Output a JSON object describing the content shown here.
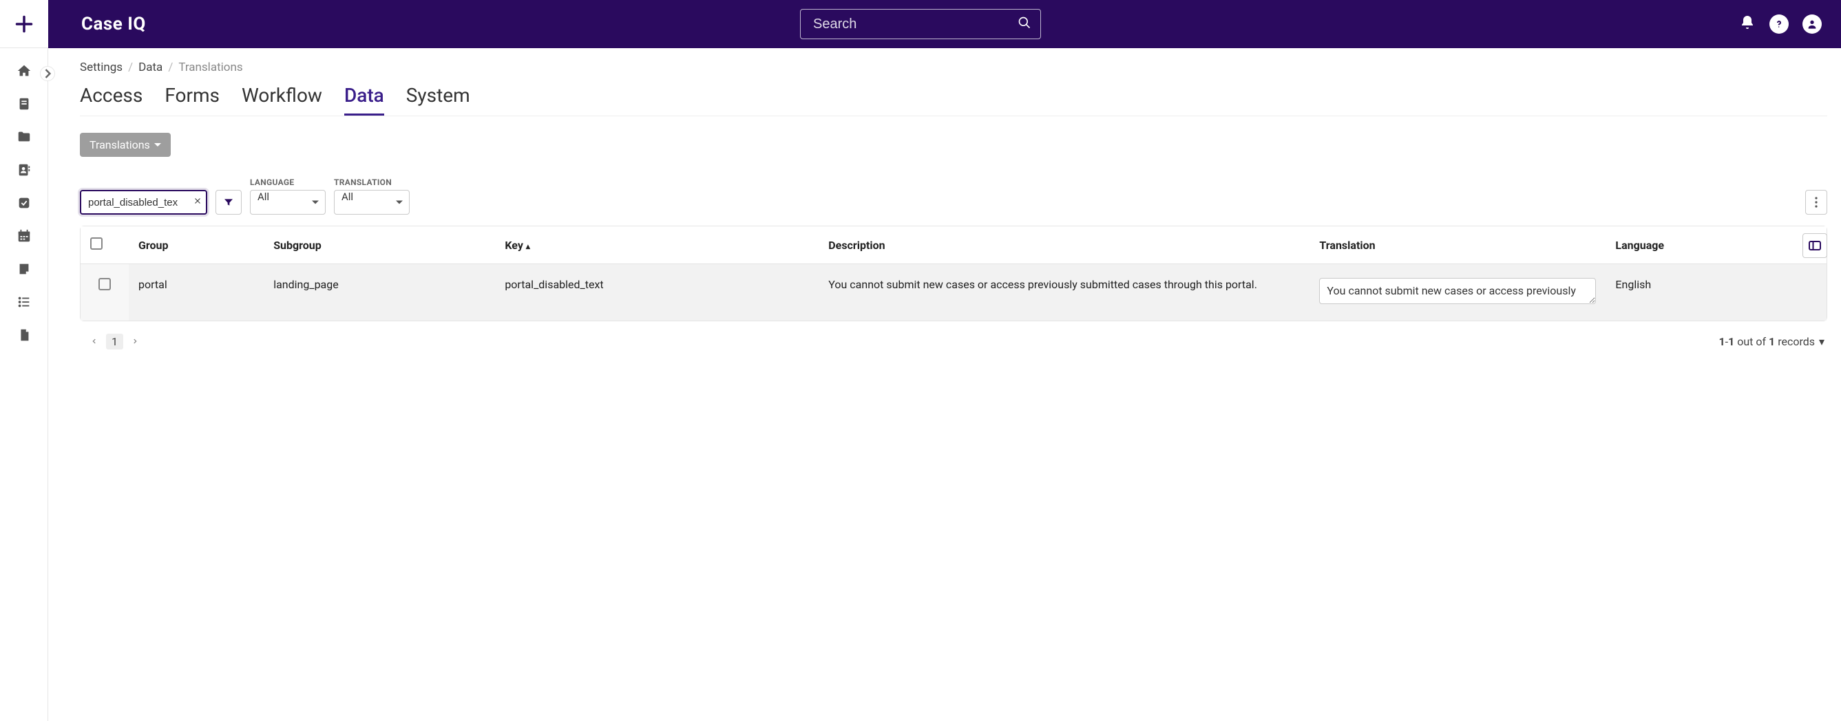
{
  "brand": {
    "name": "Case IQ"
  },
  "search": {
    "placeholder": "Search"
  },
  "breadcrumb": {
    "root": "Settings",
    "section": "Data",
    "current": "Translations"
  },
  "tabs": {
    "access": "Access",
    "forms": "Forms",
    "workflow": "Workflow",
    "data": "Data",
    "system": "System"
  },
  "chip": {
    "label": "Translations"
  },
  "filters": {
    "search_value": "portal_disabled_tex",
    "language_label": "LANGUAGE",
    "language_value": "All",
    "translation_label": "TRANSLATION",
    "translation_value": "All"
  },
  "columns": {
    "group": "Group",
    "subgroup": "Subgroup",
    "key": "Key",
    "description": "Description",
    "translation": "Translation",
    "language": "Language"
  },
  "rows": [
    {
      "group": "portal",
      "subgroup": "landing_page",
      "key": "portal_disabled_text",
      "description": "You cannot submit new cases or access previously submitted cases through this portal.",
      "translation": "You cannot submit new cases or access previously",
      "language": "English"
    }
  ],
  "pagination": {
    "page": "1",
    "range_from": "1",
    "range_to": "1",
    "mid_a": " out of ",
    "total": "1",
    "suffix": " records"
  }
}
